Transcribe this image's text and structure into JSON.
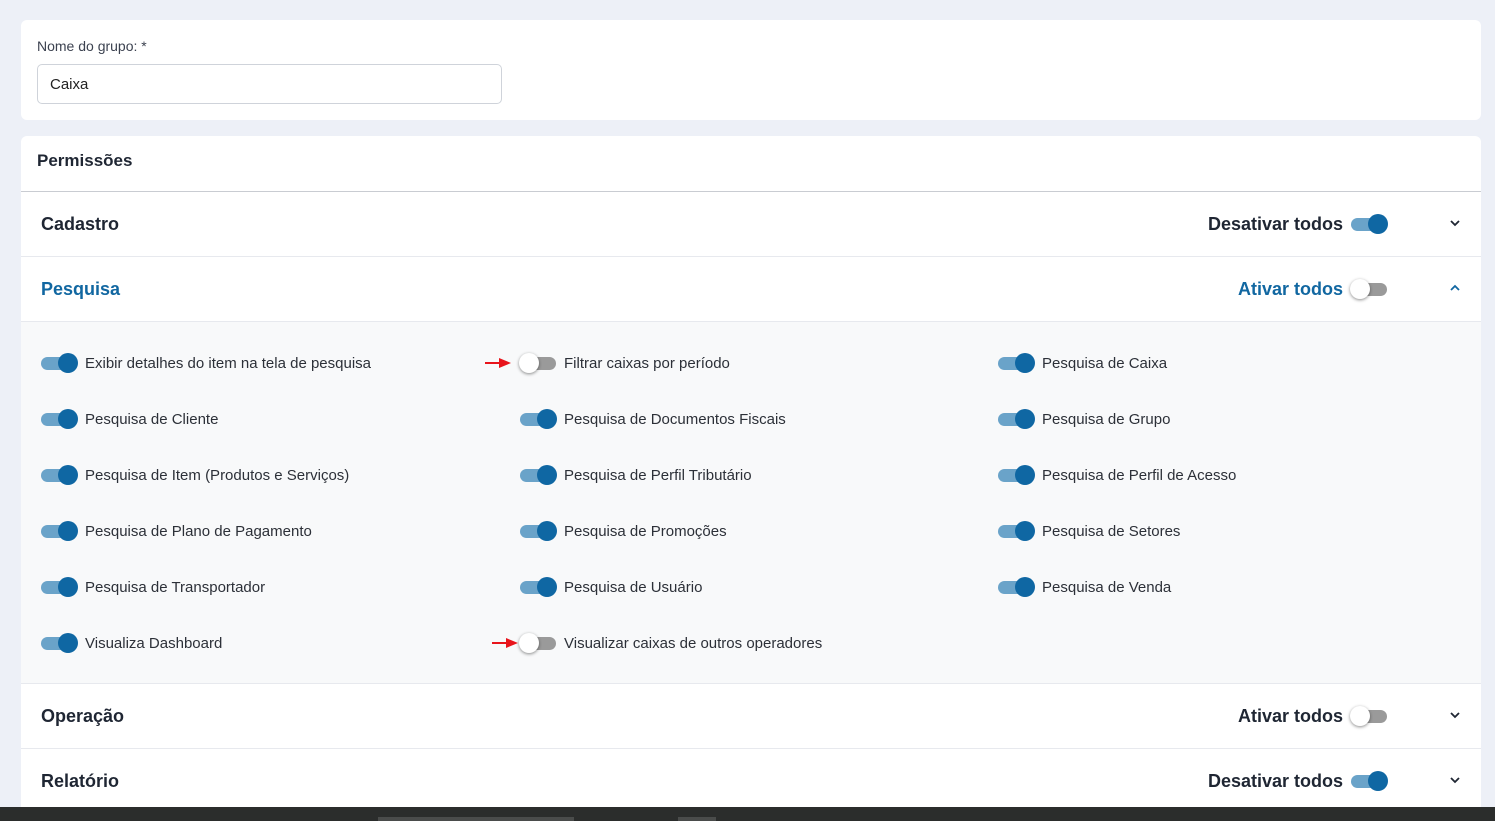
{
  "group_name": {
    "label": "Nome do grupo: *",
    "value": "Caixa"
  },
  "permissions": {
    "title": "Permissões",
    "sections": [
      {
        "title": "Cadastro",
        "toggle_all_label": "Desativar todos",
        "toggle_all_on": true,
        "expanded": false
      },
      {
        "title": "Pesquisa",
        "toggle_all_label": "Ativar todos",
        "toggle_all_on": false,
        "expanded": true
      },
      {
        "title": "Operação",
        "toggle_all_label": "Ativar todos",
        "toggle_all_on": false,
        "expanded": false
      },
      {
        "title": "Relatório",
        "toggle_all_label": "Desativar todos",
        "toggle_all_on": true,
        "expanded": false
      }
    ],
    "pesquisa_items": [
      {
        "label": "Exibir detalhes do item na tela de pesquisa",
        "on": true
      },
      {
        "label": "Filtrar caixas por período",
        "on": false,
        "marked": true
      },
      {
        "label": "Pesquisa de Caixa",
        "on": true
      },
      {
        "label": "Pesquisa de Cliente",
        "on": true
      },
      {
        "label": "Pesquisa de Documentos Fiscais",
        "on": true
      },
      {
        "label": "Pesquisa de Grupo",
        "on": true
      },
      {
        "label": "Pesquisa de Item (Produtos e Serviços)",
        "on": true
      },
      {
        "label": "Pesquisa de Perfil Tributário",
        "on": true
      },
      {
        "label": "Pesquisa de Perfil de Acesso",
        "on": true
      },
      {
        "label": "Pesquisa de Plano de Pagamento",
        "on": true
      },
      {
        "label": "Pesquisa de Promoções",
        "on": true
      },
      {
        "label": "Pesquisa de Setores",
        "on": true
      },
      {
        "label": "Pesquisa de Transportador",
        "on": true
      },
      {
        "label": "Pesquisa de Usuário",
        "on": true
      },
      {
        "label": "Pesquisa de Venda",
        "on": true
      },
      {
        "label": "Visualiza Dashboard",
        "on": true
      },
      {
        "label": "Visualizar caixas de outros operadores",
        "on": false,
        "marked": true
      }
    ]
  },
  "colors": {
    "accent": "#0f67a3",
    "switch_on_track": "#6aa3c9",
    "switch_off_track": "#9a9a9a",
    "annotation_arrow": "#e8141b"
  },
  "icons": {
    "expand": "chevron-down-icon",
    "collapse": "chevron-up-icon",
    "annotation": "red-arrow-icon"
  }
}
